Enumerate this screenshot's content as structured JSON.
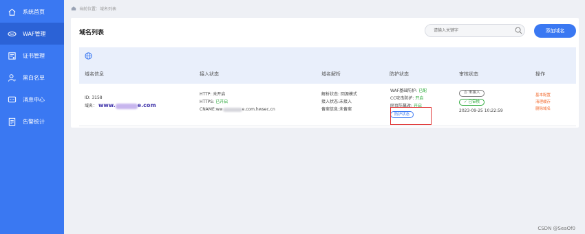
{
  "sidebar": {
    "items": [
      {
        "label": "系统首页",
        "icon": "home-icon"
      },
      {
        "label": "WAF管理",
        "icon": "waf-icon"
      },
      {
        "label": "证书管理",
        "icon": "certificate-icon"
      },
      {
        "label": "黑白名单",
        "icon": "user-icon"
      },
      {
        "label": "消息中心",
        "icon": "message-icon"
      },
      {
        "label": "告警统计",
        "icon": "document-icon"
      }
    ],
    "active_index": 1
  },
  "breadcrumb": {
    "text": "当前位置：域名列表"
  },
  "page": {
    "title": "域名列表",
    "search_placeholder": "请输入关键字",
    "add_button": "添加域名"
  },
  "table": {
    "headers": [
      "域名信息",
      "接入状态",
      "域名解析",
      "防护状态",
      "审核状态",
      "操作"
    ],
    "rows": [
      {
        "id": "ID: 3158",
        "domain_label": "域名：",
        "domain_prefix": "www.",
        "domain_suffix": "e.com",
        "http": "HTTP: 未开启",
        "https_label": "HTTPS: ",
        "https_value": "已开启",
        "cname_prefix": "CNAME:ww",
        "cname_suffix": "e.com.hwsec.cn",
        "resolve_status": "解析状态: 回源模式",
        "access_status": "接入状态:未接入",
        "record_info": "备案信息:未备案",
        "waf_label": "WAF基础防护: ",
        "waf_value": "已配",
        "cc_label": "CC攻击防护: ",
        "cc_value": "开启",
        "web_label": "网页防篡改: ",
        "web_value": "开启",
        "protect_button": "防护状态",
        "audit_not_access": "未接入",
        "audit_ok": "已审核",
        "audit_time": "2023-09-25 10:22:59",
        "ops": [
          "基本配置",
          "清理缓存",
          "删除域名"
        ]
      }
    ]
  },
  "watermark": "CSDN @SeaOf0",
  "colors": {
    "sidebar": "#3a78f2",
    "sidebar_active": "#2b62d6",
    "accent": "#3a78f2",
    "success": "#2eaa3d",
    "warning": "#f26b2f",
    "highlight_box": "#e03434"
  }
}
